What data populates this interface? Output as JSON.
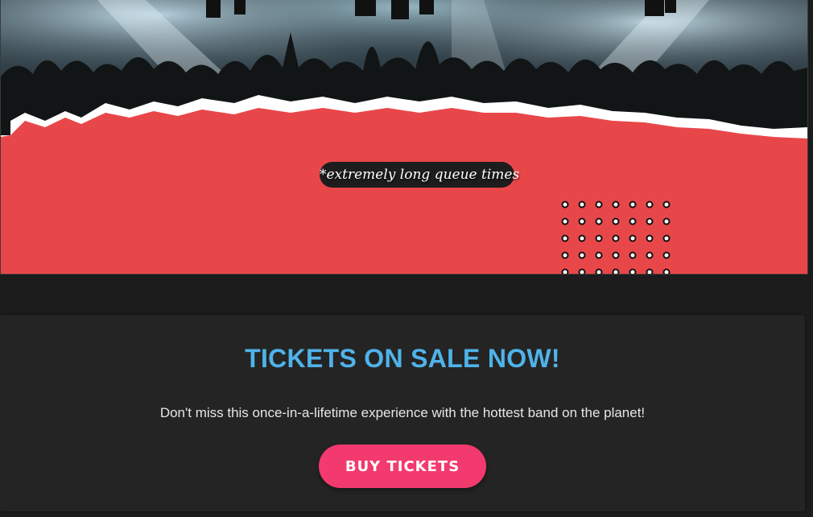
{
  "hero": {
    "queue_note": "*extremely long queue times",
    "background_color": "#e8474a"
  },
  "tickets": {
    "title": "TICKETS ON SALE NOW!",
    "description": "Don't miss this once-in-a-lifetime experience with the hottest band on the planet!",
    "button_label": "BUY TICKETS",
    "title_color": "#4fb3ea",
    "button_color": "#f23a6e"
  }
}
